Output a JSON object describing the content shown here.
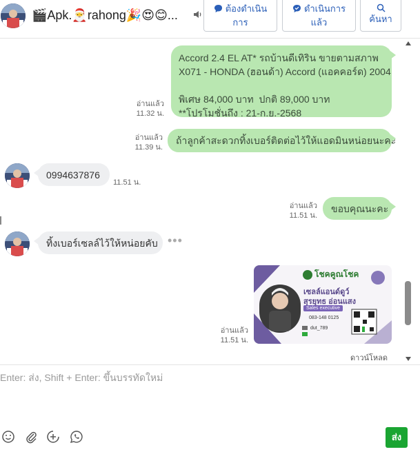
{
  "header": {
    "title": "🎬Apk.🎅rahong🎉😍😊...",
    "buttons": {
      "todo": "ต้องดำเนิน\nการ",
      "done": "ดำเนินการ\nแล้ว",
      "search": "ค้นหา"
    }
  },
  "messages": [
    {
      "direction": "out",
      "text": "Accord 2.4 EL AT* รถบ้านดีเทิริน ขายตามสภาพ\nX071 - HONDA (ฮอนด้า) Accord (แอคคอร์ด) 2004\n\nพิเศษ 84,000 บาท  ปกติ 89,000 บาท\n**โปรโมชั่นถึง : 21-ก.ย.-2568",
      "status": "อ่านแล้ว",
      "time": "11.32 น."
    },
    {
      "direction": "out",
      "text": "ถ้าลูกค้าสะดวกทิ้งเบอร์ติดต่อไว้ให้แอดมินหน่อยนะคะ",
      "status": "อ่านแล้ว",
      "time": "11.39 น."
    },
    {
      "direction": "in",
      "text": "0994637876",
      "time": "11.51 น."
    },
    {
      "direction": "out",
      "text": "ขอบคุณนะคะ",
      "status": "อ่านแล้ว",
      "time": "11.51 น."
    },
    {
      "direction": "in",
      "text": "ทิ้งเบอร์เซลล์ไว้ให้หน่อยคับ",
      "more": "•••"
    },
    {
      "direction": "out",
      "type": "image",
      "status": "อ่านแล้ว",
      "time": "11.51 น.",
      "download": "ดาวน์โหลด"
    }
  ],
  "card": {
    "brand": "โชคคูณโชค",
    "name": "เซลล์แอนด์ดูว์",
    "person": "สุรยุทธ อ่อนแสง",
    "role": "Sales executive",
    "phone": "083-148 0125",
    "line": "dut_789"
  },
  "composer": {
    "placeholder": "Enter: ส่ง, Shift + Enter: ขึ้นบรรทัดใหม่",
    "send_label": "ส่ง",
    "tools": [
      "emoji-icon",
      "attach-icon",
      "add-icon",
      "whatsapp-icon"
    ]
  },
  "colors": {
    "outgoing_bubble": "#b9e7b1",
    "incoming_bubble": "#eeeff1",
    "accent_blue": "#2b5fb8",
    "send_green": "#1aa532"
  }
}
